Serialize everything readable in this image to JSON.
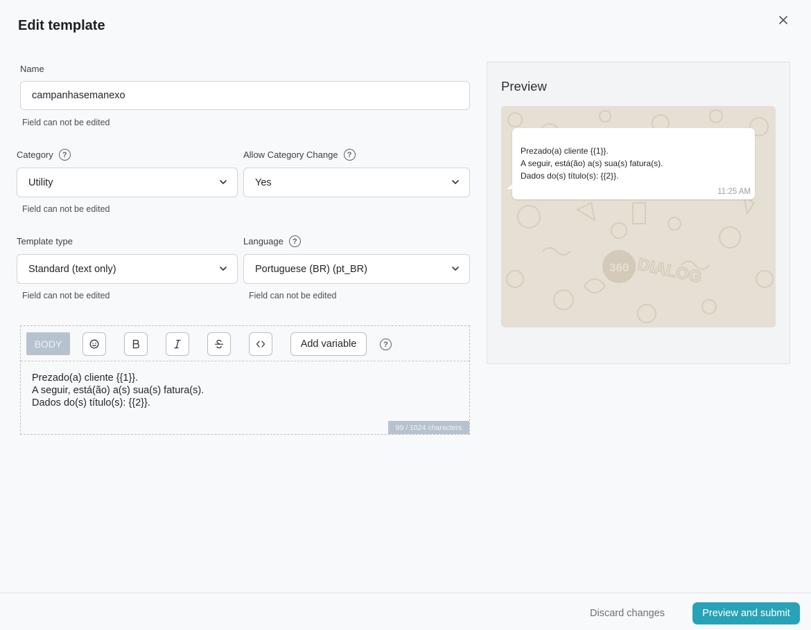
{
  "title": "Edit template",
  "close_icon": "close-icon",
  "name_field": {
    "label": "Name",
    "value": "campanhasemanexo",
    "hint": "Field can not be edited"
  },
  "category": {
    "label": "Category",
    "value": "Utility",
    "hint": "Field can not be edited"
  },
  "allow_category_change": {
    "label": "Allow Category Change",
    "value": "Yes"
  },
  "template_type": {
    "label": "Template type",
    "value": "Standard (text only)",
    "hint": "Field can not be edited"
  },
  "language": {
    "label": "Language",
    "value": "Portuguese (BR) (pt_BR)",
    "hint": "Field can not be edited"
  },
  "editor": {
    "section_tag": "BODY",
    "add_variable_label": "Add variable",
    "body_text": "Prezado(a) cliente {{1}}.\nA seguir, está(ão) a(s) sua(s) fatura(s).\nDados do(s) título(s): {{2}}.",
    "char_count": "99 / 1024 characters",
    "toolbar_icons": [
      "emoji-icon",
      "bold-icon",
      "italic-icon",
      "strikethrough-icon",
      "code-icon",
      "help-icon"
    ]
  },
  "preview": {
    "title": "Preview",
    "message": "Prezado(a) cliente {{1}}.\nA seguir, está(ão) a(s) sua(s) fatura(s).\nDados do(s) título(s): {{2}}.",
    "time": "11:25 AM",
    "watermark": "360 DIALOG"
  },
  "footer": {
    "discard_label": "Discard changes",
    "submit_label": "Preview and submit"
  },
  "colors": {
    "primary": "#28a2b7",
    "tag_bg": "#b7c2cf",
    "wa_bg": "#e6dfd3"
  }
}
